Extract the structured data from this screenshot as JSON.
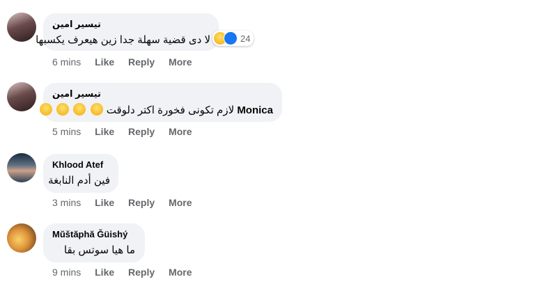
{
  "comments": [
    {
      "author": "تيسير امين",
      "text": "لا دى قضية سهلة جدا زين هيعرف يكسبها",
      "reaction_count": "24",
      "reaction_icons": [
        "laugh-icon",
        "like-icon"
      ],
      "time": "6 mins",
      "like": "Like",
      "reply": "Reply",
      "more": "More"
    },
    {
      "author": "تيسير امين",
      "mention": "Monica",
      "text": "لازم تكونى فخورة اكتر دلوقت",
      "emoji_count": 4,
      "time": "5 mins",
      "like": "Like",
      "reply": "Reply",
      "more": "More"
    },
    {
      "author": "Khlood Atef",
      "text": "فين أدم النابغة",
      "time": "3 mins",
      "like": "Like",
      "reply": "Reply",
      "more": "More"
    },
    {
      "author": "Mŭštăphă Ğüishý",
      "text": "ما هيا سوتس بقا",
      "time": "9 mins",
      "like": "Like",
      "reply": "Reply",
      "more": "More"
    }
  ],
  "colors": {
    "bubble": "#f0f2f5",
    "action_text": "#65676b",
    "like_blue": "#1877f2",
    "laugh_yellow": "#f7b928"
  }
}
